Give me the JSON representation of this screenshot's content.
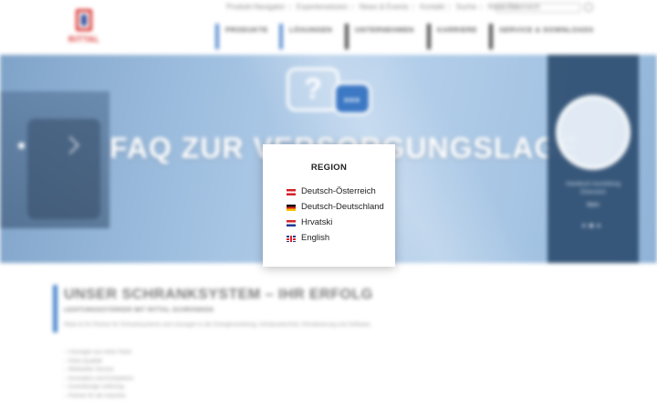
{
  "header": {
    "logo_text": "RITTAL",
    "top_links": [
      "Produkt-Navigator",
      "Expertenwissen",
      "News & Events",
      "Kontakt",
      "Suche",
      "Rittal Österreich"
    ],
    "search_placeholder": "Suche",
    "nav": [
      {
        "label": "PRODUKTE"
      },
      {
        "label": "LÖSUNGEN"
      },
      {
        "label": "UNTERNEHMEN"
      },
      {
        "label": "KARRIERE"
      },
      {
        "label": "SERVICE & DOWNLOADS"
      }
    ]
  },
  "hero": {
    "title": "FAQ ZUR VERSORGUNGSLAGE",
    "bubble_q": "?",
    "bubble_dots": "•••",
    "side": {
      "text": "Handbuch Ausstellung Österreich",
      "more": "Mehr"
    }
  },
  "content": {
    "heading": "UNSER SCHRANKSYSTEM – IHR ERFOLG",
    "subheading": "LEISTUNGSSTÄRKER MIT RITTAL SCHRÄNKEN",
    "intro": "Rittal ist Ihr Partner für Schranksysteme und Lösungen in der Energieverteilung, Gehäusetechnik, Klimatisierung und Software.",
    "bullets": [
      "– Lösungen aus einer Hand",
      "– Hohe Qualität",
      "– Weltweiter Service",
      "– Innovation und Kompetenz",
      "– Zuverlässige Lieferung",
      "– Partner für die Industrie"
    ]
  },
  "modal": {
    "title": "REGION",
    "regions": [
      {
        "label": "Deutsch-Österreich",
        "flag": "at-flag-icon"
      },
      {
        "label": "Deutsch-Deutschland",
        "flag": "de-flag-icon"
      },
      {
        "label": "Hrvatski",
        "flag": "hr-flag-icon"
      },
      {
        "label": "English",
        "flag": "gb-flag-icon"
      }
    ]
  },
  "colors": {
    "brand_red": "#d9302c",
    "accent_blue": "#4a86cc",
    "hero_panel": "#2f4f72"
  }
}
